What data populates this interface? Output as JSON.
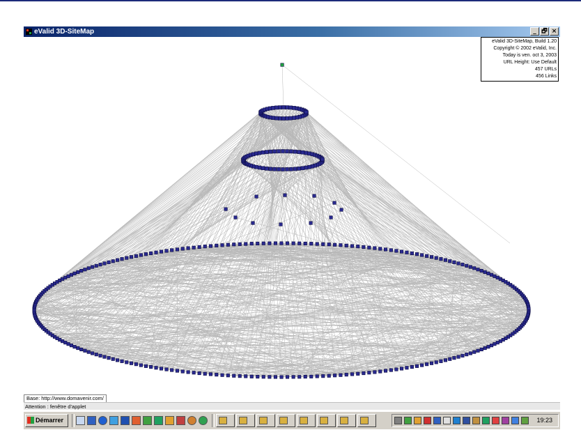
{
  "window": {
    "title": "eValid 3D-SiteMap",
    "controls": [
      "_",
      "🗗",
      "×"
    ]
  },
  "info_panel": [
    "eValid 3D-SiteMap, Build 1.20",
    "Copyright © 2002 eValid, Inc.",
    "Today is ven. oct 3, 2003",
    "URL Height: Use Default",
    "457 URLs",
    "456 Links"
  ],
  "status": {
    "base": "Base: http://www.domavenir.com/",
    "attention": "Attention : fenêtre d'applet"
  },
  "taskbar": {
    "start_label": "Démarrer",
    "clock": "19:23"
  },
  "colors": {
    "title_start": "#0a246a",
    "title_end": "#a6caf0",
    "node": "#2a2a90",
    "root_node": "#20a040",
    "edges": "#b8b8b8"
  }
}
